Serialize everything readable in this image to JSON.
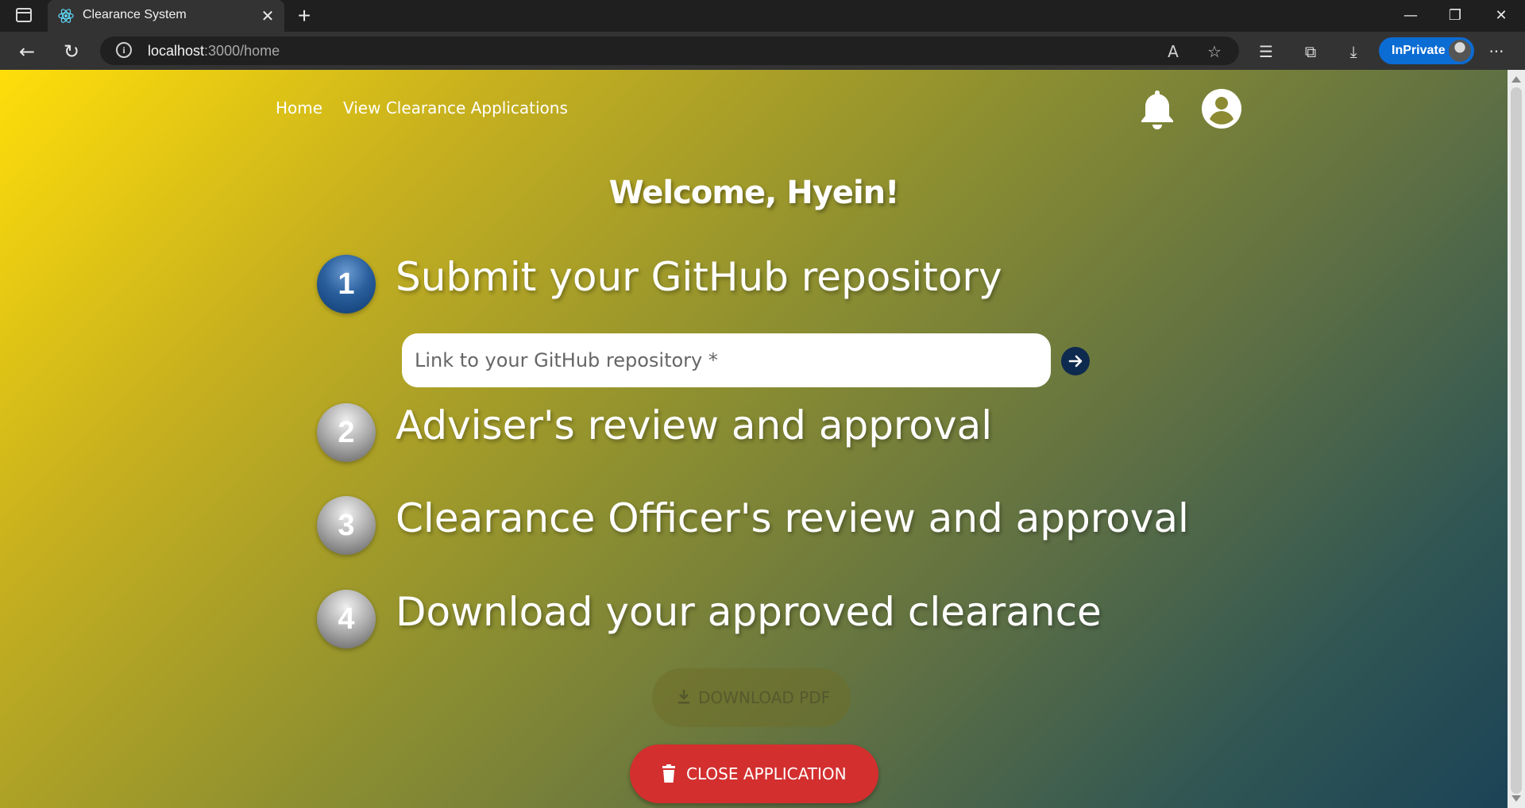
{
  "browser": {
    "tab_title": "Clearance System",
    "new_tab_symbol": "+",
    "url_host": "localhost",
    "url_path": ":3000/home",
    "inprivate_label": "InPrivate"
  },
  "nav": {
    "home_label": "Home",
    "view_applications_label": "View Clearance Applications"
  },
  "welcome_text": "Welcome, Hyein!",
  "steps": [
    {
      "number": "1",
      "text": "Submit your GitHub repository",
      "state": "active"
    },
    {
      "number": "2",
      "text": "Adviser's review and approval",
      "state": "pending"
    },
    {
      "number": "3",
      "text": "Clearance Officer's review and approval",
      "state": "pending"
    },
    {
      "number": "4",
      "text": "Download your approved clearance",
      "state": "pending"
    }
  ],
  "repo_input": {
    "placeholder": "Link to your GitHub repository *",
    "value": ""
  },
  "buttons": {
    "download_pdf": "DOWNLOAD PDF",
    "close_application": "CLOSE APPLICATION"
  },
  "colors": {
    "active_step": "#2a5f9d",
    "close_button": "#d32f2f",
    "inprivate_badge": "#0b6cd4"
  }
}
